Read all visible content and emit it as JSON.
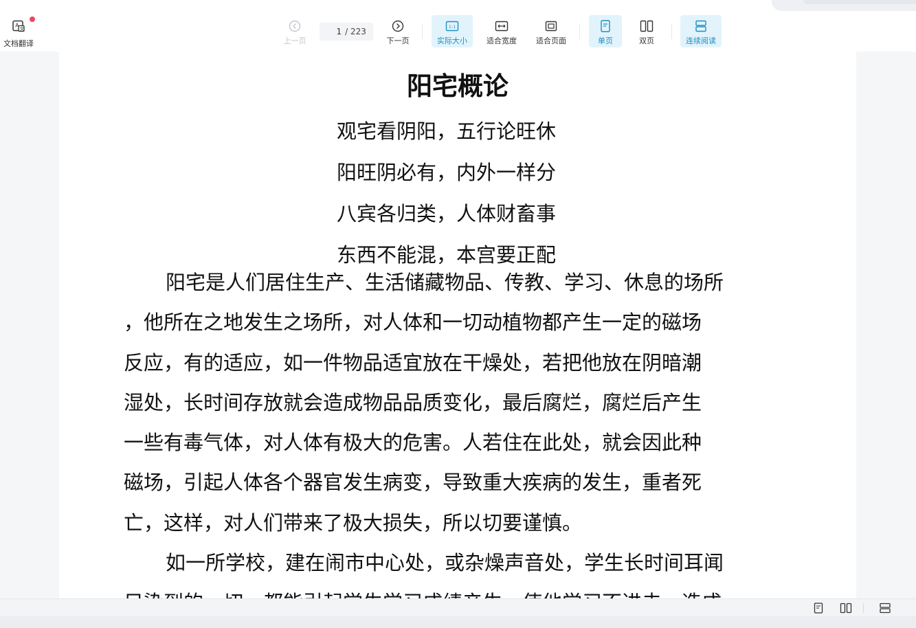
{
  "toolbar": {
    "translate_label": "文档翻译",
    "prev_label": "上一页",
    "current_page": "1",
    "total_pages": "/ 223",
    "next_label": "下一页",
    "actual_size_label": "实际大小",
    "actual_size_badge": "1:1",
    "fit_width_label": "适合宽度",
    "fit_page_label": "适合页面",
    "single_page_label": "单页",
    "double_page_label": "双页",
    "continuous_label": "连续阅读"
  },
  "document": {
    "title": "阳宅概论",
    "poem": [
      "观宅看阴阳，五行论旺休",
      "阳旺阴必有，内外一样分",
      "八宾各归类，人体财畜事",
      "东西不能混，本宫要正配"
    ],
    "paragraph1": [
      "阳宅是人们居住生产、生活储藏物品、传教、学习、休息的场所",
      "，他所在之地发生之场所，对人体和一切动植物都产生一定的磁场",
      "反应，有的适应，如一件物品适宜放在干燥处，若把他放在阴暗潮",
      "湿处，长时间存放就会造成物品品质变化，最后腐烂，腐烂后产生",
      "一些有毒气体，对人体有极大的危害。人若住在此处，就会因此种",
      "磁场，引起人体各个器官发生病变，导致重大疾病的发生，重者死",
      "亡，这样，对人们带来了极大损失，所以切要谨慎。"
    ],
    "paragraph2": [
      "如一所学校，建在闹市中心处，或杂燥声音处，学生长时间耳闻",
      "目染到的一切，都能引起学生学习成绩产生，使他学习不进去，造成"
    ]
  },
  "colors": {
    "accent": "#1b8fc4",
    "active_bg": "#e2f3fb",
    "notification_dot": "#ef4562"
  }
}
